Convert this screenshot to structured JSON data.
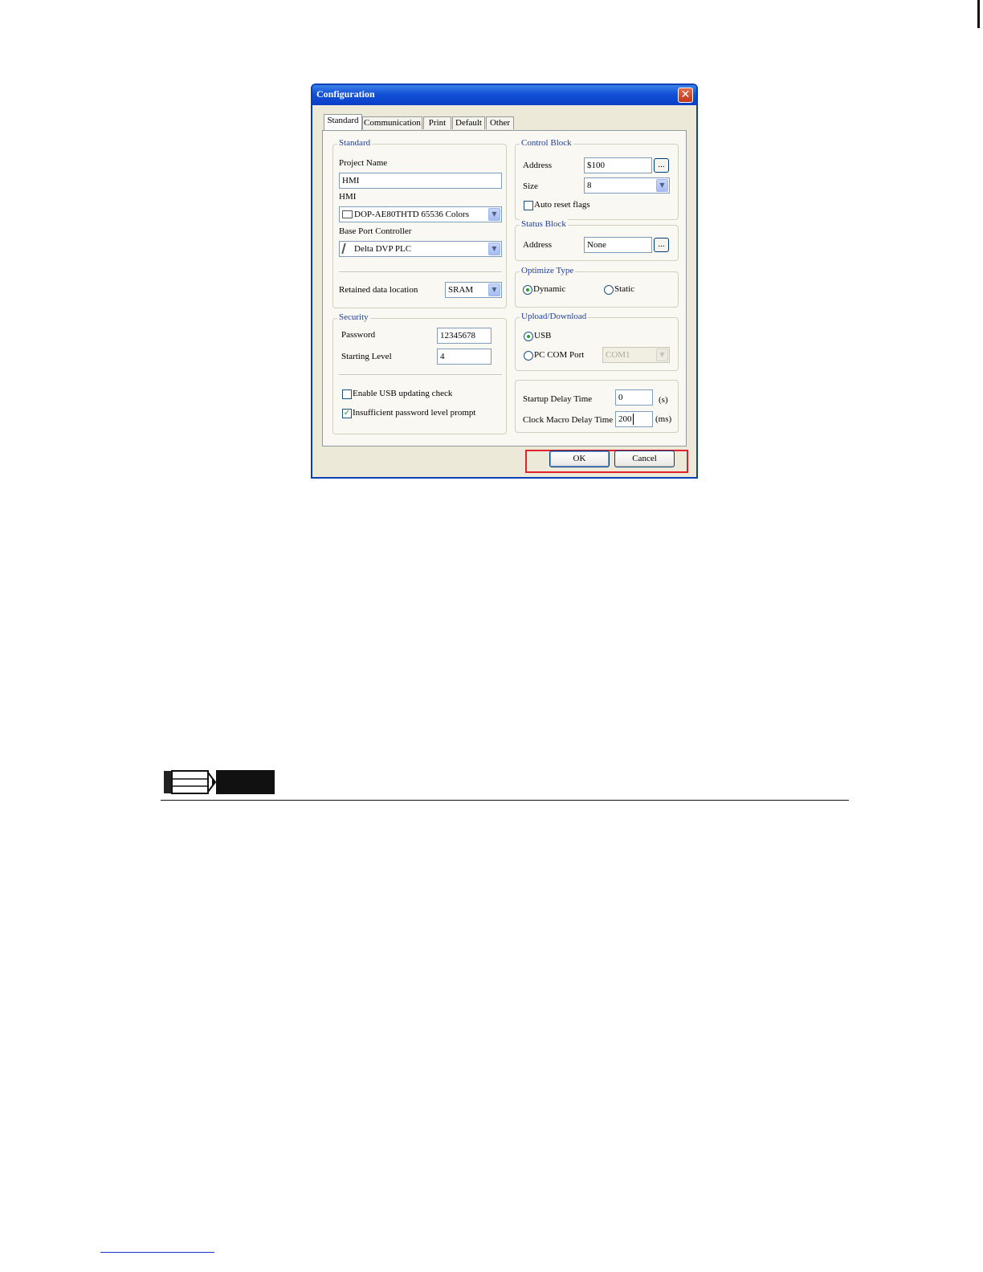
{
  "dialog": {
    "title": "Configuration",
    "close_glyph": "✕",
    "tabs": [
      "Standard",
      "Communication",
      "Print",
      "Default",
      "Other"
    ],
    "standard": {
      "legend": "Standard",
      "project_name_label": "Project Name",
      "project_name_value": "HMI",
      "hmi_label": "HMI",
      "hmi_value": "DOP-AE80THTD 65536 Colors",
      "base_port_label": "Base Port Controller",
      "base_port_value": "Delta DVP PLC",
      "retained_label": "Retained data location",
      "retained_value": "SRAM"
    },
    "security": {
      "legend": "Security",
      "password_label": "Password",
      "password_value": "12345678",
      "starting_level_label": "Starting Level",
      "starting_level_value": "4",
      "usb_check_label": "Enable USB updating check",
      "usb_check_checked": false,
      "insufficient_label": "Insufficient password level prompt",
      "insufficient_checked": true,
      "check_glyph": "✓"
    },
    "control_block": {
      "legend": "Control Block",
      "address_label": "Address",
      "address_value": "$100",
      "size_label": "Size",
      "size_value": "8",
      "auto_reset_label": "Auto reset flags",
      "auto_reset_checked": false
    },
    "status_block": {
      "legend": "Status Block",
      "address_label": "Address",
      "address_value": "None"
    },
    "optimize": {
      "legend": "Optimize Type",
      "dynamic_label": "Dynamic",
      "static_label": "Static",
      "selected": "Dynamic"
    },
    "upload": {
      "legend": "Upload/Download",
      "usb_label": "USB",
      "pc_com_label": "PC COM Port",
      "com_value": "COM1",
      "selected": "USB"
    },
    "delay": {
      "startup_label": "Startup Delay Time",
      "startup_value": "0",
      "startup_unit": "(s)",
      "clock_label": "Clock Macro Delay Time",
      "clock_value": "200",
      "clock_unit": "(ms)"
    },
    "ellipsis": "...",
    "dropdown_glyph": "▼",
    "ok_label": "OK",
    "cancel_label": "Cancel",
    "highlight_color": "#e0202b"
  }
}
